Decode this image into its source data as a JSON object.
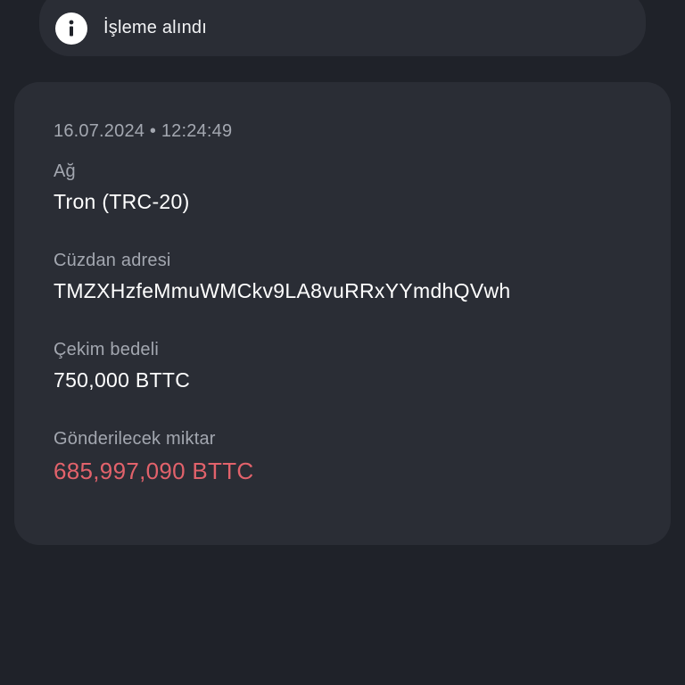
{
  "notice": {
    "icon": "info-icon",
    "text": "İşleme alındı"
  },
  "transaction": {
    "timestamp": "16.07.2024 • 12:24:49",
    "network": {
      "label": "Ağ",
      "value": "Tron (TRC-20)"
    },
    "wallet_address": {
      "label": "Cüzdan adresi",
      "value": "TMZXHzfeMmuWMCkv9LA8vuRRxYYmdhQVwh"
    },
    "withdrawal_fee": {
      "label": "Çekim bedeli",
      "value": "750,000 BTTC"
    },
    "amount_to_send": {
      "label": "Gönderilecek miktar",
      "value": "685,997,090 BTTC",
      "color": "#e2626b"
    }
  },
  "colors": {
    "background": "#1f2229",
    "card": "#2a2d35",
    "label": "#a3a7b0",
    "value": "#ffffff",
    "accent": "#e2626b"
  }
}
